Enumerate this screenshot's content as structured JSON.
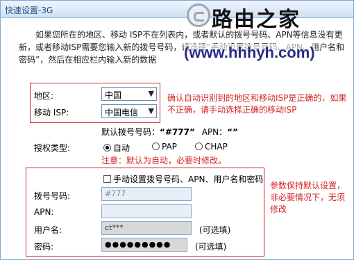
{
  "window": {
    "title": "快速设置-3G"
  },
  "watermark": {
    "brand": "路由之家",
    "url": "(www.hhhyh.com)"
  },
  "intro": "如果您所在的地区、移动 ISP不在列表内，或者默认的拨号号码、APN等信息没有更新，或者移动ISP需要您输入新的拨号号码，请选择“手动设置拨号号码、APN、用户名和密码”，然后在相应栏内输入新的数据",
  "region": {
    "label": "地区:",
    "value": "中国"
  },
  "isp": {
    "label": "移动 ISP:",
    "value": "中国电信"
  },
  "note_confirm": "确认自动识别到的地区和移动ISP是正确的，如果不正确，请手动选择正确的移动ISP",
  "default_dial": {
    "label": "默认拨号号码：",
    "number": "“#777”",
    "apn_label": "APN：",
    "apn": "“”"
  },
  "auth": {
    "label": "授权类型:",
    "options": [
      "自动",
      "PAP",
      "CHAP"
    ],
    "selected": "自动",
    "note": "注意：默认为自动，必要时修改。"
  },
  "manual": {
    "checkbox_label": "手动设置拨号号码、APN、用户名和密码",
    "checked": false,
    "dial_label": "拨号号码:",
    "dial_value": "#777",
    "apn_label": "APN:",
    "apn_value": "",
    "user_label": "用户名:",
    "user_value": "ct***",
    "user_hint": "(可选填)",
    "pass_label": "密码:",
    "pass_value": "●●●●●●●●●",
    "pass_hint": "(可选填)"
  },
  "note_keep": "参数保持默认设置，非必要情况下，无须修改"
}
